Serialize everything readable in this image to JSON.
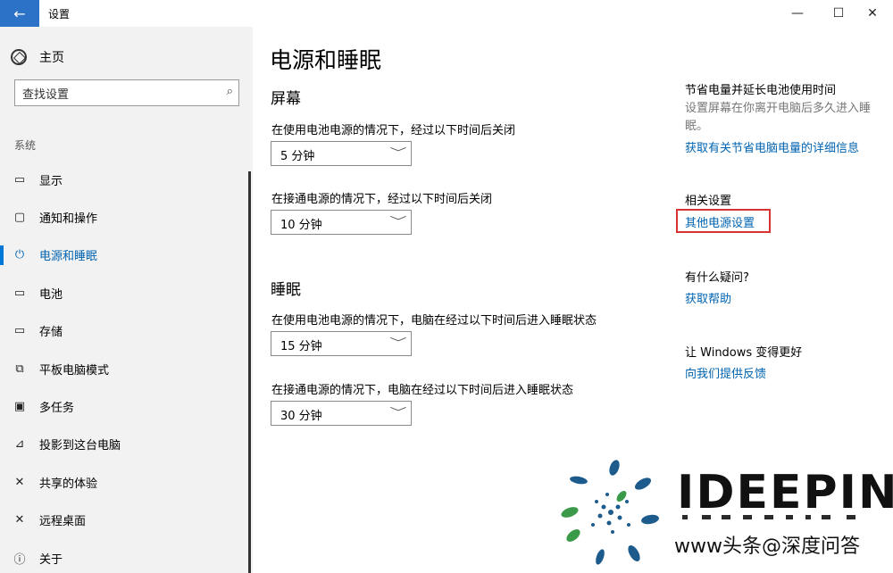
{
  "window": {
    "title": "设置",
    "back_icon": "←",
    "min_icon": "—",
    "max_icon": "☐",
    "close_icon": "✕"
  },
  "sidebar": {
    "home_label": "主页",
    "search_placeholder": "查找设置",
    "search_icon": "⌕",
    "section_label": "系统",
    "items": [
      {
        "label": "显示",
        "icon": "▭"
      },
      {
        "label": "通知和操作",
        "icon": "▢"
      },
      {
        "label": "电源和睡眠",
        "icon": "⏻",
        "active": true
      },
      {
        "label": "电池",
        "icon": "▭"
      },
      {
        "label": "存储",
        "icon": "▭"
      },
      {
        "label": "平板电脑模式",
        "icon": "⧉"
      },
      {
        "label": "多任务",
        "icon": "▣"
      },
      {
        "label": "投影到这台电脑",
        "icon": "⊿"
      },
      {
        "label": "共享的体验",
        "icon": "✕"
      },
      {
        "label": "远程桌面",
        "icon": "✕"
      },
      {
        "label": "关于",
        "icon": "ⓘ"
      }
    ]
  },
  "main": {
    "title": "电源和睡眠",
    "screen": {
      "heading": "屏幕",
      "battery_desc": "在使用电池电源的情况下，经过以下时间后关闭",
      "battery_value": "5 分钟",
      "plugged_desc": "在接通电源的情况下，经过以下时间后关闭",
      "plugged_value": "10 分钟"
    },
    "sleep": {
      "heading": "睡眠",
      "battery_desc": "在使用电池电源的情况下，电脑在经过以下时间后进入睡眠状态",
      "battery_value": "15 分钟",
      "plugged_desc": "在接通电源的情况下，电脑在经过以下时间后进入睡眠状态",
      "plugged_value": "30 分钟"
    },
    "chevron": "﹀"
  },
  "right": {
    "save_heading": "节省电量并延长电池使用时间",
    "save_text": "设置屏幕在你离开电脑后多久进入睡眠。",
    "save_link": "获取有关节省电脑电量的详细信息",
    "related_heading": "相关设置",
    "related_link": "其他电源设置",
    "question_heading": "有什么疑问?",
    "help_link": "获取帮助",
    "improve_heading": "让 Windows 变得更好",
    "feedback_link": "向我们提供反馈"
  },
  "watermark": {
    "brand": "IDEEPIN",
    "sub": "www头条@深度问答"
  },
  "colors": {
    "accent": "#0078d7",
    "link": "#0063b1",
    "highlight": "#d93232",
    "sidebar_bg": "#f2f2f2"
  }
}
